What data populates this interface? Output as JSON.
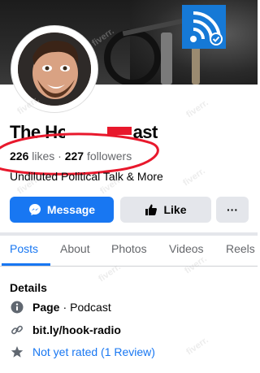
{
  "page": {
    "title_visible": "The Ho",
    "title_tail": "ast",
    "likes_count": "226",
    "likes_label": "likes",
    "separator": "·",
    "followers_count": "227",
    "followers_label": "followers",
    "tagline": "Undiluted Political Talk & More"
  },
  "actions": {
    "message_label": "Message",
    "like_label": "Like",
    "more_label": "···"
  },
  "tabs": [
    {
      "label": "Posts",
      "active": true
    },
    {
      "label": "About",
      "active": false
    },
    {
      "label": "Photos",
      "active": false
    },
    {
      "label": "Videos",
      "active": false
    },
    {
      "label": "Reels",
      "active": false
    }
  ],
  "details": {
    "heading": "Details",
    "category_prefix": "Page",
    "category_separator": "·",
    "category": "Podcast",
    "website": "bit.ly/hook-radio",
    "rating": "Not yet rated (1 Review)"
  },
  "watermark": "fiverr.",
  "colors": {
    "accent": "#1877f2",
    "annotation": "#e8182c",
    "button_grey": "#e4e6eb"
  }
}
